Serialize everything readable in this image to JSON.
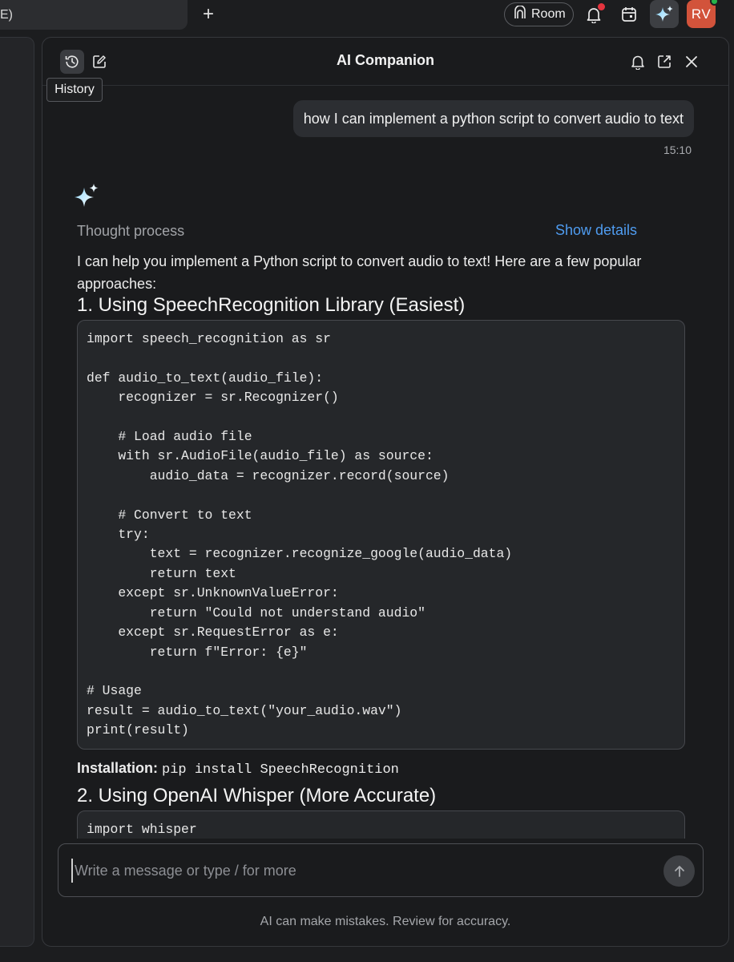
{
  "topbar": {
    "prev_tab_fragment": "E)",
    "new_tab_label": "+",
    "room_label": "Room",
    "avatar_initials": "RV",
    "colors": {
      "avatar": "#d2533b",
      "notification_dot": "#e5343e",
      "online_dot": "#26b24a"
    }
  },
  "panel": {
    "title": "AI Companion",
    "tooltip": "History",
    "header_icons": [
      "history-icon",
      "new-chat-icon",
      "bell-icon",
      "pop-out-icon",
      "close-icon"
    ]
  },
  "chat": {
    "user_message": "how I can implement a python script to convert audio to text",
    "user_time": "15:10",
    "thought_label": "Thought process",
    "show_details": "Show details",
    "intro": "I can help you implement a Python script to convert audio to text! Here are a few popular approaches:",
    "section1_heading": "1. Using SpeechRecognition Library (Easiest)",
    "code1": "import speech_recognition as sr\n\ndef audio_to_text(audio_file):\n    recognizer = sr.Recognizer()\n\n    # Load audio file\n    with sr.AudioFile(audio_file) as source:\n        audio_data = recognizer.record(source)\n\n    # Convert to text\n    try:\n        text = recognizer.recognize_google(audio_data)\n        return text\n    except sr.UnknownValueError:\n        return \"Could not understand audio\"\n    except sr.RequestError as e:\n        return f\"Error: {e}\"\n\n# Usage\nresult = audio_to_text(\"your_audio.wav\")\nprint(result)",
    "install_label": "Installation:",
    "install_command": "pip install SpeechRecognition",
    "section2_heading": "2. Using OpenAI Whisper (More Accurate)",
    "code2": "import whisper"
  },
  "composer": {
    "placeholder": "Write a message or type / for more",
    "value": ""
  },
  "footer": {
    "disclaimer": "AI can make mistakes. Review for accuracy."
  },
  "colors": {
    "link": "#4f9cf0",
    "panel_bg": "#1a1b1d",
    "code_bg": "#25272a"
  }
}
